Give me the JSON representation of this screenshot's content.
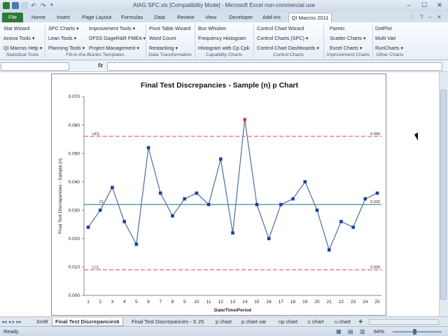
{
  "window": {
    "title": "AIAG SPC.xls  [Compatibility Mode]  -  Microsoft Excel non-commercial use"
  },
  "ribbon_tabs": [
    "File",
    "Home",
    "Insert",
    "Page Layout",
    "Formulas",
    "Data",
    "Review",
    "View",
    "Developer",
    "Add-Ins",
    "QI Macros 2011"
  ],
  "ribbon_groups": [
    {
      "name": "Statistical Tools",
      "items": [
        "Stat Wizard",
        "Anova Tools ▾",
        "QI Macros Help ▾"
      ]
    },
    {
      "name": "Fill-in-the-Blanks Templates",
      "items": [
        "SPC Charts ▾",
        "Improvement Tools ▾",
        "Lean Tools ▾",
        "DFSS GageR&R FMEA ▾",
        "Planning Tools ▾",
        "Project Management ▾"
      ]
    },
    {
      "name": "Data Transformation",
      "items": [
        "Pivot Table Wizard",
        "Word Count",
        "Restacking ▾"
      ]
    },
    {
      "name": "Capability Charts",
      "items": [
        "Box Whisker",
        "Frequency Histogram",
        "Histogram with Cp Cpk"
      ]
    },
    {
      "name": "Control Charts",
      "items": [
        "Control Chart Wizard",
        "Control Charts (SPC) ▾",
        "Control Chart Dashboards ▾"
      ]
    },
    {
      "name": "Improvement Charts",
      "items": [
        "Pareto",
        "Scatter Charts ▾",
        "Excel Charts ▾"
      ]
    },
    {
      "name": "Other Charts",
      "items": [
        "DotPlot",
        "Multi Vari",
        "RunCharts ▾"
      ]
    }
  ],
  "formula_bar": {
    "fx_label": "fx",
    "name_box": "",
    "value": ""
  },
  "chart_data": {
    "type": "line",
    "title": "Final Test Discrepancies - Sample (n) p Chart",
    "xlabel": "Date/Time/Period",
    "ylabel": "Final Test Discrepancies - Sample (n)",
    "categories": [
      "1",
      "2",
      "3",
      "4",
      "5",
      "6",
      "7",
      "8",
      "9",
      "10",
      "11",
      "12",
      "13",
      "14",
      "15",
      "16",
      "17",
      "18",
      "19",
      "20",
      "21",
      "22",
      "23",
      "24",
      "25"
    ],
    "series": [
      {
        "values": [
          0.024,
          0.03,
          0.038,
          0.026,
          0.018,
          0.052,
          0.036,
          0.028,
          0.034,
          0.036,
          0.032,
          0.048,
          0.022,
          0.062,
          0.032,
          0.02,
          0.032,
          0.034,
          0.04,
          0.03,
          0.016,
          0.026,
          0.024,
          0.034,
          0.036
        ]
      }
    ],
    "out_of_control_points": [
      14
    ],
    "ylim": [
      0.0,
      0.07
    ],
    "yticks": [
      "0.000",
      "0.010",
      "0.020",
      "0.030",
      "0.040",
      "0.050",
      "0.060",
      "0.070"
    ],
    "limits": {
      "ucl": 0.056,
      "cl": 0.032,
      "lcl": 0.009,
      "ucl_label": "UCL",
      "cl_label": "CL",
      "lcl_label": "LCL",
      "ucl_value": "0.056",
      "cl_value": "0.032",
      "lcl_value": "0.009"
    },
    "colors": {
      "line": "#4a6fa5",
      "marker": "#1f3f9c",
      "limit": "#d9534f",
      "center": "#2f7f8f",
      "ooc": "#e02020"
    },
    "grid": false
  },
  "sheet_tabs": [
    "XmR",
    "Final Test Discrepancies6",
    "Final Test Discrepancies - S 25",
    "p chart",
    "p chart var",
    "np chart",
    "c chart",
    "u chart"
  ],
  "active_sheet": "Final Test Discrepancies6",
  "status": {
    "text": "Ready",
    "zoom": "84%"
  }
}
